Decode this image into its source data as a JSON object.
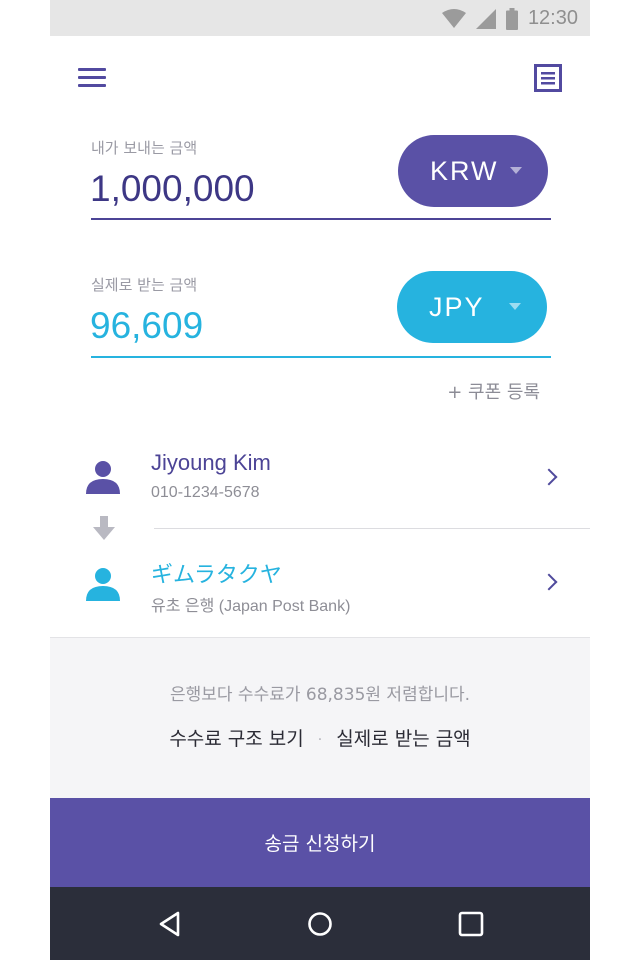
{
  "status_bar": {
    "time": "12:30"
  },
  "header": {
    "menu_icon": "hamburger-menu-icon",
    "list_icon": "document-list-icon"
  },
  "send": {
    "label": "내가 보내는 금액",
    "amount": "1,000,000",
    "currency": "KRW",
    "color": "#5a51a6",
    "text_color": "#3d3785"
  },
  "receive": {
    "label": "실제로 받는 금액",
    "amount": "96,609",
    "currency": "JPY",
    "color": "#26b3df",
    "text_color": "#26b3df"
  },
  "coupon": {
    "label": "+ 쿠폰 등록"
  },
  "sender": {
    "name": "Jiyoung Kim",
    "phone": "010-1234-5678",
    "name_color": "#4c4496"
  },
  "recipient": {
    "name": "ギムラタクヤ",
    "bank": "유초 은행 (Japan Post Bank)",
    "name_color": "#26b3df"
  },
  "info": {
    "message": "은행보다 수수료가 68,835원 저렴합니다.",
    "link_fee": "수수료 구조 보기",
    "separator": "·",
    "link_receive": "실제로 받는 금액"
  },
  "submit": {
    "label": "송금 신청하기"
  },
  "nav": {
    "back_icon": "back-triangle-icon",
    "home_icon": "home-circle-icon",
    "recents_icon": "recents-square-icon"
  }
}
